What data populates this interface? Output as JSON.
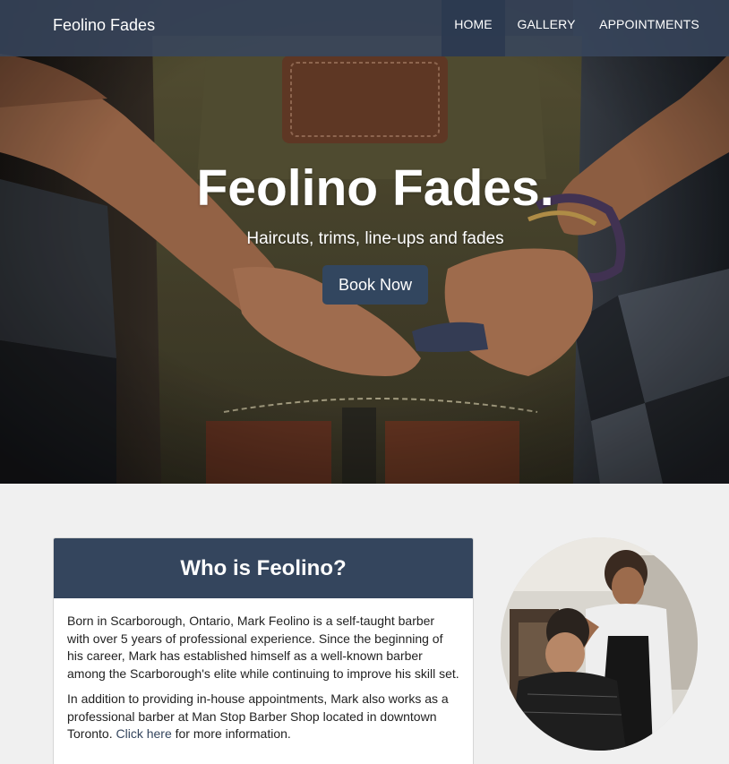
{
  "nav": {
    "brand": "Feolino Fades",
    "items": [
      {
        "label": "HOME",
        "active": true
      },
      {
        "label": "GALLERY"
      },
      {
        "label": "APPOINTMENTS"
      }
    ]
  },
  "hero": {
    "title": "Feolino Fades.",
    "subtitle": "Haircuts, trims, line-ups and fades",
    "cta": "Book Now"
  },
  "about": {
    "heading": "Who is Feolino?",
    "p1": "Born in Scarborough, Ontario, Mark Feolino is a self-taught barber with over 5 years of professional experience. Since the beginning of his career, Mark has established himself as a well-known barber among the Scarborough's elite while continuing to improve his skill set.",
    "p2_before": "In addition to providing in-house appointments, Mark also works as a professional barber at Man Stop Barber Shop located in downtown Toronto.",
    "p2_link": "Click here",
    "p2_after": "for more information."
  },
  "colors": {
    "navbar": "#38465c",
    "accent": "#34455d",
    "page_bg": "#f0f0f0"
  }
}
